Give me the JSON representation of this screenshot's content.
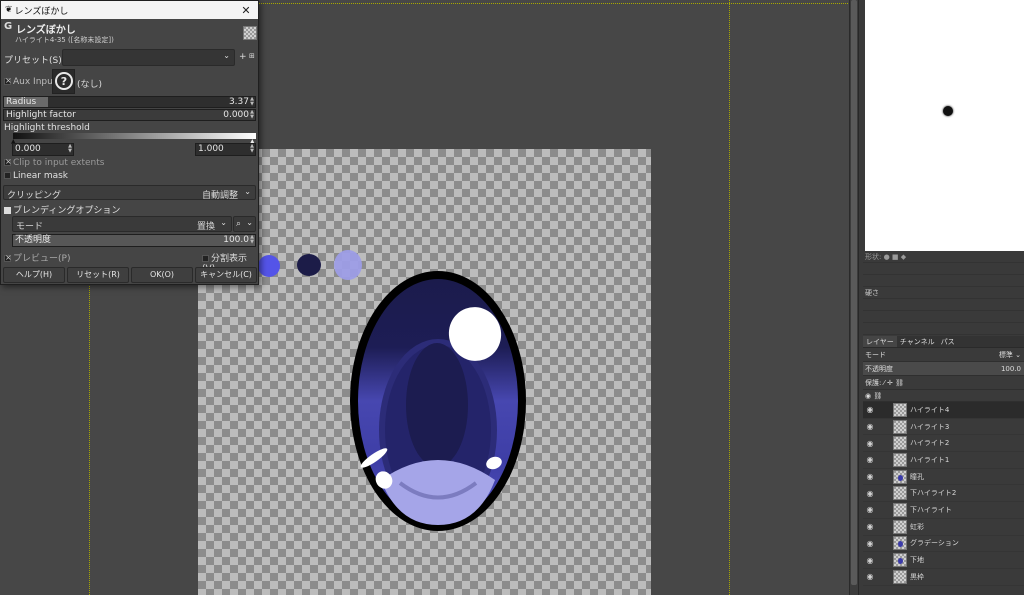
{
  "dialog": {
    "title": "レンズぼかし",
    "header_glyph": "G",
    "header_title": "レンズぼかし",
    "header_subtitle": "ハイライト4-35 ([名称未設定])",
    "preset_label": "プリセット(S):",
    "preset_value": "",
    "aux_input_label": "Aux Input",
    "aux_input_value": "(なし)",
    "radius_label": "Radius",
    "radius_value": "3.37",
    "highlight_factor_label": "Highlight factor",
    "highlight_factor_value": "0.000",
    "highlight_threshold_label": "Highlight threshold",
    "threshold_low": "0.000",
    "threshold_high": "1.000",
    "clip_label": "Clip to input extents",
    "linear_mask_label": "Linear mask",
    "clipping_label": "クリッピング",
    "clipping_value": "自動調整",
    "blend_options_label": "ブレンディングオプション",
    "mode_label": "モード",
    "mode_value": "置換",
    "opacity_label": "不透明度",
    "opacity_value": "100.0",
    "preview_label": "プレビュー(P)",
    "split_label": "分割表示(V)",
    "buttons": {
      "help": "ヘルプ(H)",
      "reset": "リセット(R)",
      "ok": "OK(O)",
      "cancel": "キャンセル(C)"
    }
  },
  "tool_options": {
    "shape_label": "形状:",
    "hardness_label": "硬さ"
  },
  "layers_panel": {
    "tabs": [
      "レイヤー",
      "チャンネル",
      "パス"
    ],
    "mode_label": "モード",
    "mode_value": "標準",
    "opacity_label": "不透明度",
    "opacity_value": "100.0",
    "lock_label": "保護:",
    "layers": [
      {
        "name": "ハイライト4",
        "selected": true
      },
      {
        "name": "ハイライト3"
      },
      {
        "name": "ハイライト2"
      },
      {
        "name": "ハイライト1"
      },
      {
        "name": "瞳孔"
      },
      {
        "name": "下ハイライト2"
      },
      {
        "name": "下ハイライト"
      },
      {
        "name": "虹彩"
      },
      {
        "name": "グラデーション"
      },
      {
        "name": "下地"
      },
      {
        "name": "黒枠"
      }
    ]
  },
  "colors": {
    "eye_dark": "#1a1a4a",
    "eye_mid": "#3e3ea8",
    "eye_light": "#b8b8ee",
    "outline": "#000000",
    "swatch_1": "#5454e8",
    "swatch_2": "#1c1c48",
    "swatch_3": "#9d9de6"
  }
}
